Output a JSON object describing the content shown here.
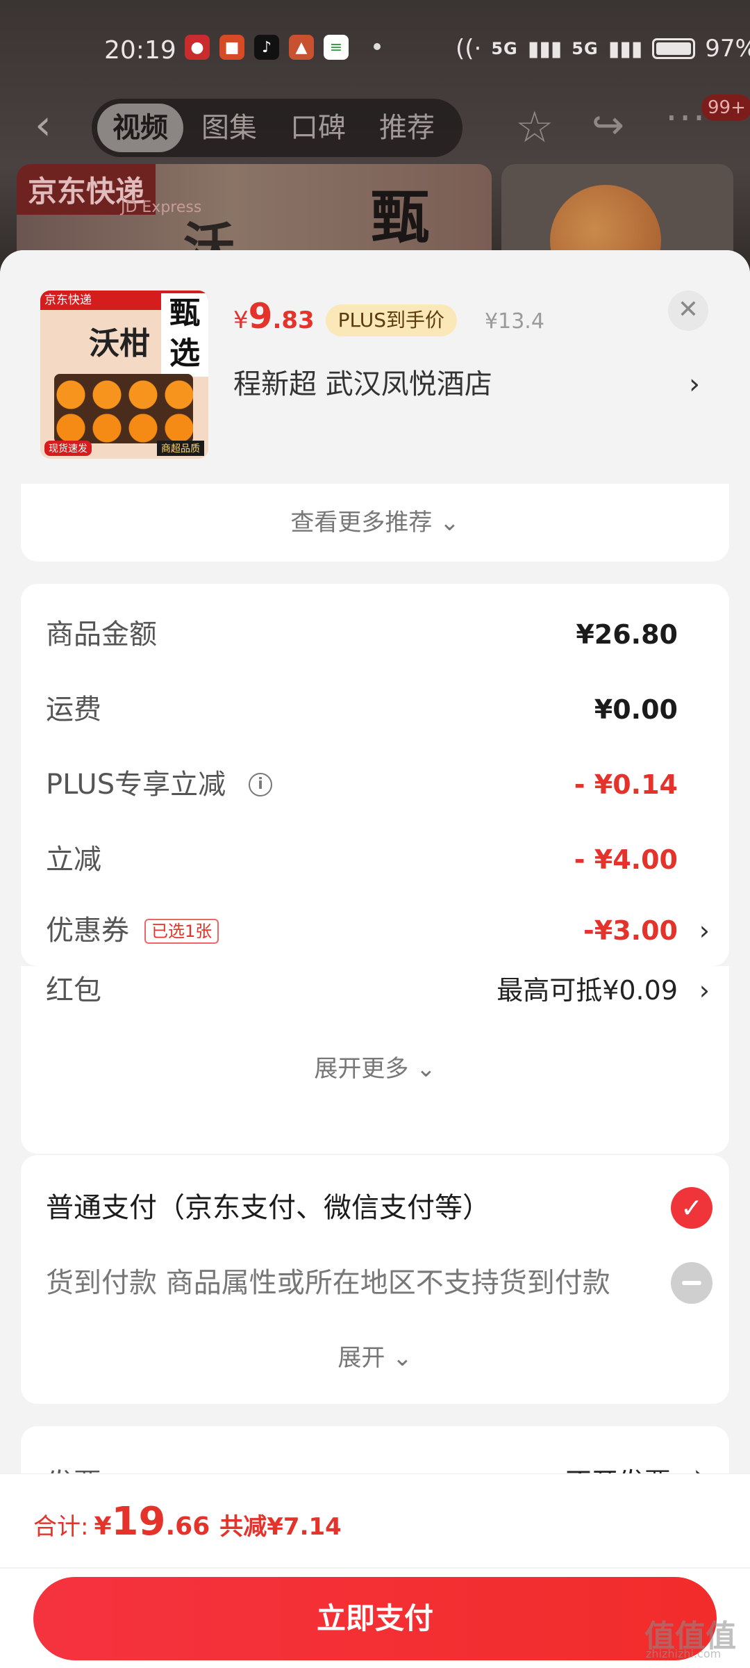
{
  "status_bar": {
    "time": "20:19",
    "signal_1": "5G",
    "signal_2": "5G",
    "battery": "97%"
  },
  "top_nav": {
    "tabs": [
      {
        "label": "视频",
        "active": true
      },
      {
        "label": "图集",
        "active": false
      },
      {
        "label": "口碑",
        "active": false
      },
      {
        "label": "推荐",
        "active": false
      }
    ],
    "badge": "99+"
  },
  "background": {
    "express_label": "京东快递",
    "express_sub": "JD Express"
  },
  "product": {
    "price_symbol": "¥",
    "price_int": "9",
    "price_dec": ".83",
    "plus_tag": "PLUS到手价",
    "original_price": "¥13.4",
    "address": "程新超  武汉凤悦酒店",
    "thumb_top": "京东快递",
    "thumb_big": "甄选",
    "thumb_mid": "沃柑",
    "thumb_tag_left": "现货速发",
    "thumb_tag_right": "商超品质"
  },
  "more_recommend": "查看更多推荐 ⌄",
  "price_detail": {
    "rows": [
      {
        "label": "商品金额",
        "value": "¥26.80"
      },
      {
        "label": "运费",
        "value": "¥0.00"
      },
      {
        "label": "PLUS专享立减",
        "value": "- ¥0.14"
      },
      {
        "label": "立减",
        "value": "- ¥4.00"
      },
      {
        "label": "优惠券",
        "tag": "已选1张",
        "value": "-¥3.00"
      },
      {
        "label": "红包",
        "value": "最高可抵¥0.09"
      }
    ],
    "expand_more": "展开更多 ⌄"
  },
  "payment": {
    "normal_label": "普通支付（京东支付、微信支付等）",
    "cod_label": "货到付款   商品属性或所在地区不支持货到付款",
    "expand": "展开 ⌄"
  },
  "invoice": {
    "label": "发票",
    "value": "不开发票"
  },
  "bottom": {
    "total_label": "合计:",
    "total_symbol": "¥",
    "total_int": "19",
    "total_dec": ".66",
    "saved": "共减¥7.14",
    "pay_button": "立即支付"
  },
  "watermark": {
    "main": "值值值",
    "sub": "zhizhizhi.com"
  },
  "colors": {
    "accent_red": "#e4332b",
    "pay_button": "#f5333f",
    "plus_tag_bg": "#fbe8b9"
  }
}
